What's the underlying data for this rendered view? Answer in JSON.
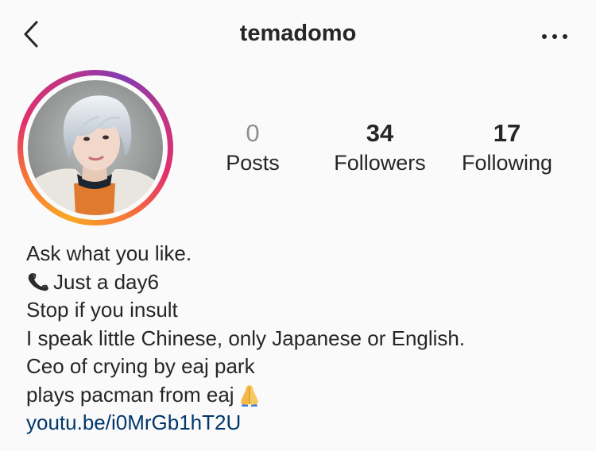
{
  "header": {
    "username": "temadomo",
    "back_icon": "chevron-left-icon",
    "more_icon": "more-options-icon"
  },
  "stats": [
    {
      "value": "0",
      "label": "Posts"
    },
    {
      "value": "34",
      "label": "Followers"
    },
    {
      "value": "17",
      "label": "Following"
    }
  ],
  "bio": {
    "line1": "Ask what you like.",
    "line2": "Just a day6",
    "line3": "Stop if you insult",
    "line4": "I speak little Chinese, only Japanese or English.",
    "line5": "Ceo of crying by eaj park",
    "line6": "plays pacman from eaj",
    "link": "youtu.be/i0MrGb1hT2U"
  },
  "colors": {
    "text": "#262626",
    "muted": "#8e8e8e",
    "link": "#00376b",
    "background": "#fafafa"
  }
}
